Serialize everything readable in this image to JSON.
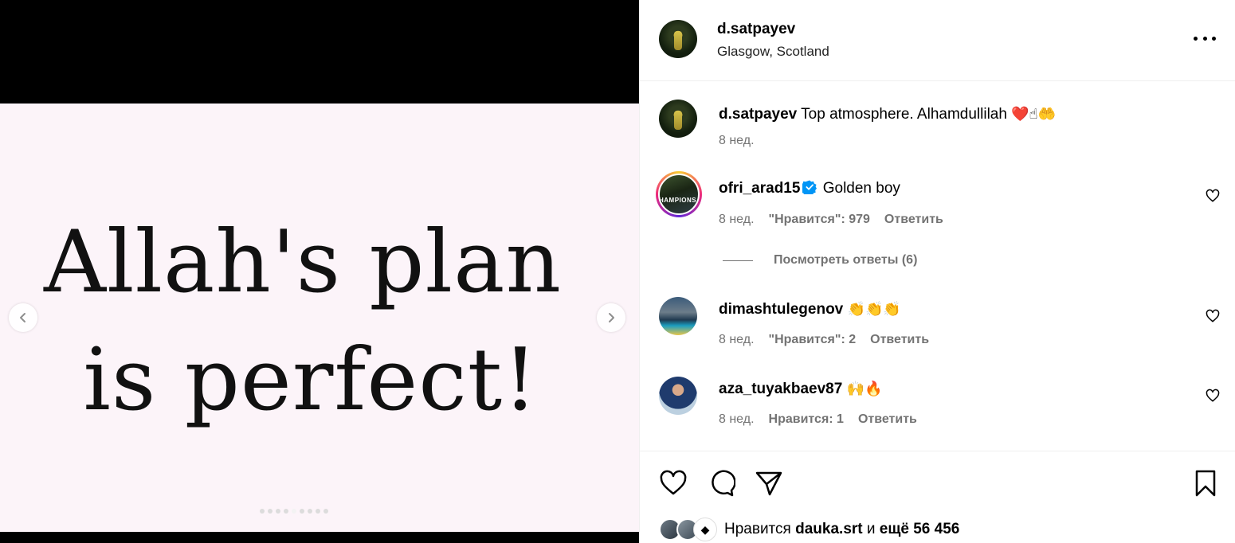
{
  "post": {
    "author": "d.satpayev",
    "location": "Glasgow, Scotland",
    "image_text_line1": "Allah's plan",
    "image_text_line2": "is perfect!",
    "carousel_dot_count": 9,
    "carousel_active_index": 4
  },
  "caption": {
    "user": "d.satpayev",
    "text": "Top atmosphere. Alhamdullilah",
    "emojis": "❤️☝🤲",
    "time": "8 нед."
  },
  "comments": [
    {
      "user": "ofri_arad15",
      "verified": true,
      "text": "Golden boy",
      "time": "8 нед.",
      "likes": "\"Нравится\": 979",
      "reply": "Ответить",
      "avatar_icon": "story-ring-avatar"
    },
    {
      "user": "dimashtulegenov",
      "verified": false,
      "text": "👏👏👏",
      "time": "8 нед.",
      "likes": "\"Нравится\": 2",
      "reply": "Ответить",
      "avatar_icon": "avatar"
    },
    {
      "user": "aza_tuyakbaev87",
      "verified": false,
      "text": "🙌🔥",
      "time": "8 нед.",
      "likes": "Нравится: 1",
      "reply": "Ответить",
      "avatar_icon": "avatar"
    }
  ],
  "view_replies": "Посмотреть ответы (6)",
  "likes_summary": {
    "prefix": "Нравится",
    "user": "dauka.srt",
    "conjunction": "и",
    "rest": "ещё 56 456"
  },
  "icons": {
    "prev": "chevron-left-icon",
    "next": "chevron-right-icon",
    "more": "more-options-icon",
    "like": "heart-icon",
    "comment": "comment-icon",
    "share": "share-icon",
    "save": "bookmark-icon",
    "verified": "verified-badge-icon"
  },
  "colors": {
    "verified": "#0095f6",
    "muted_text": "#737373",
    "image_background": "#fcf4f9"
  }
}
